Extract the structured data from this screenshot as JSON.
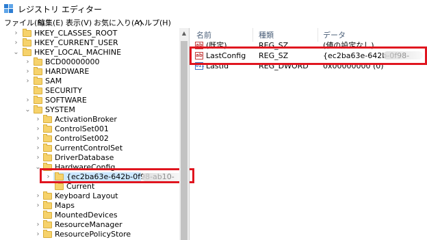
{
  "window": {
    "title": "レジストリ エディター"
  },
  "menu": [
    "ファイル(F)",
    "編集(E)",
    "表示(V)",
    "お気に入り(A)",
    "ヘルプ(H)"
  ],
  "tree": [
    {
      "label": "HKEY_CLASSES_ROOT",
      "expander": "›"
    },
    {
      "label": "HKEY_CURRENT_USER",
      "expander": "›"
    },
    {
      "label": "HKEY_LOCAL_MACHINE",
      "expander": "⌄"
    },
    {
      "label": "BCD00000000",
      "expander": "›"
    },
    {
      "label": "HARDWARE",
      "expander": "›"
    },
    {
      "label": "SAM",
      "expander": "›"
    },
    {
      "label": "SECURITY",
      "expander": ""
    },
    {
      "label": "SOFTWARE",
      "expander": "›"
    },
    {
      "label": "SYSTEM",
      "expander": "⌄"
    },
    {
      "label": "ActivationBroker",
      "expander": "›"
    },
    {
      "label": "ControlSet001",
      "expander": "›"
    },
    {
      "label": "ControlSet002",
      "expander": "›"
    },
    {
      "label": "CurrentControlSet",
      "expander": "›"
    },
    {
      "label": "DriverDatabase",
      "expander": "›"
    },
    {
      "label": "HardwareConfig",
      "expander": "⌄"
    },
    {
      "label": "{ec2ba63e-642b-0f98-ab10-",
      "expander": "›"
    },
    {
      "label": "Current",
      "expander": ""
    },
    {
      "label": "Keyboard Layout",
      "expander": "›"
    },
    {
      "label": "Maps",
      "expander": "›"
    },
    {
      "label": "MountedDevices",
      "expander": ""
    },
    {
      "label": "ResourceManager",
      "expander": "›"
    },
    {
      "label": "ResourcePolicyStore",
      "expander": "›"
    }
  ],
  "list": {
    "columns": [
      "名前",
      "種類",
      "データ"
    ],
    "rows": [
      {
        "name": "(既定)",
        "type": "REG_SZ",
        "data": "(値の設定なし)",
        "icon": "ab"
      },
      {
        "name": "LastConfig",
        "type": "REG_SZ",
        "data": "{ec2ba63e-642b-0f98-",
        "icon": "ab"
      },
      {
        "name": "LastId",
        "type": "REG_DWORD",
        "data": "0x00000000 (0)",
        "icon": "dword"
      }
    ]
  }
}
